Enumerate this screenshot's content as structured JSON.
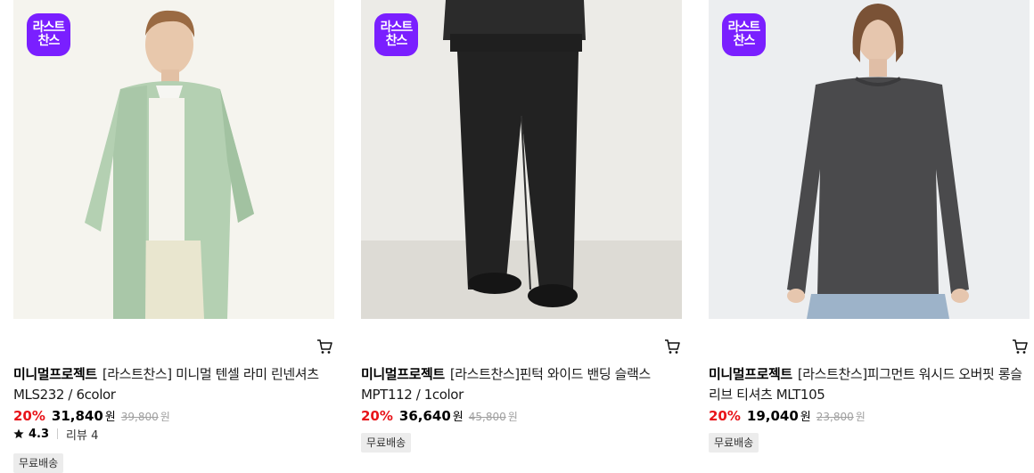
{
  "products": [
    {
      "badge_line1": "라스트",
      "badge_line2": "찬스",
      "brand": "미니멀프로젝트",
      "name": "[라스트찬스] 미니멀 텐셀 라미 린넨셔츠 MLS232 / 6color",
      "discount": "20%",
      "sale_price": "31,840",
      "currency": "원",
      "original_price": "39,800",
      "rating": "4.3",
      "review_label": "리뷰 4",
      "shipping": "무료배송",
      "image_icon": "model-in-mint-linen-shirt"
    },
    {
      "badge_line1": "라스트",
      "badge_line2": "찬스",
      "brand": "미니멀프로젝트",
      "name": "[라스트찬스]핀턱 와이드 밴딩 슬랙스 MPT112 / 1color",
      "discount": "20%",
      "sale_price": "36,640",
      "currency": "원",
      "original_price": "45,800",
      "rating": null,
      "review_label": null,
      "shipping": "무료배송",
      "image_icon": "model-in-black-wide-slacks"
    },
    {
      "badge_line1": "라스트",
      "badge_line2": "찬스",
      "brand": "미니멀프로젝트",
      "name": "[라스트찬스]피그먼트 워시드 오버핏 롱슬리브 티셔츠 MLT105",
      "discount": "20%",
      "sale_price": "19,040",
      "currency": "원",
      "original_price": "23,800",
      "rating": null,
      "review_label": null,
      "shipping": "무료배송",
      "image_icon": "model-in-charcoal-longsleeve-tee"
    }
  ],
  "colors": {
    "badge": "#7a1fff",
    "discount": "#e8141a",
    "muted": "#a0a0a0",
    "tag_bg": "#ececec"
  }
}
